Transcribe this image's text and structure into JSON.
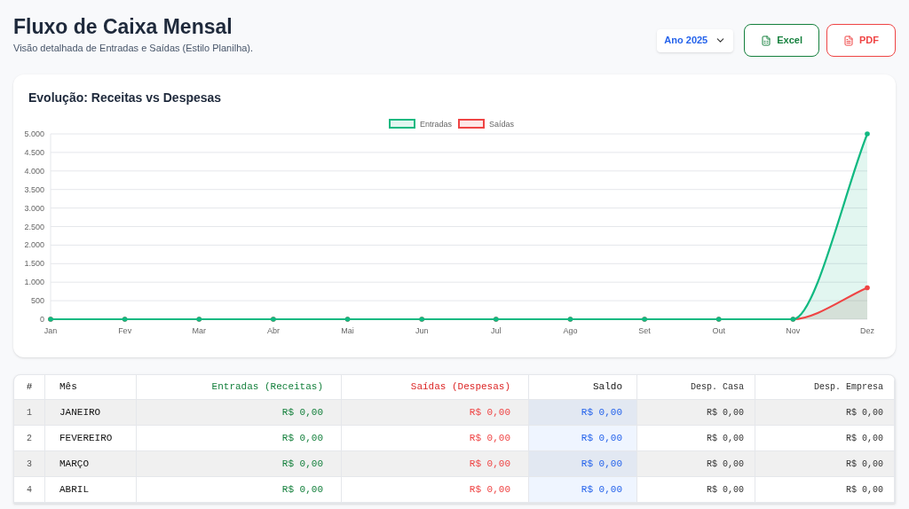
{
  "header": {
    "title": "Fluxo de Caixa Mensal",
    "subtitle": "Visão detalhada de Entradas e Saídas (Estilo Planilha).",
    "year_select": "Ano 2025",
    "buttons": [
      {
        "kind": "excel",
        "label": "Excel"
      },
      {
        "kind": "pdf",
        "label": "PDF"
      }
    ]
  },
  "chart_card": {
    "title": "Evolução: Receitas vs Despesas",
    "chart_data": {
      "type": "area",
      "grid": true,
      "legend": true,
      "categories": [
        "Jan",
        "Fev",
        "Mar",
        "Abr",
        "Mai",
        "Jun",
        "Jul",
        "Ago",
        "Set",
        "Out",
        "Nov",
        "Dez"
      ],
      "ylim": [
        0,
        5000
      ],
      "yticks": [
        {
          "value": 0,
          "label": "0"
        },
        {
          "value": 500,
          "label": "500"
        },
        {
          "value": 1000,
          "label": "1.000"
        },
        {
          "value": 1500,
          "label": "1.500"
        },
        {
          "value": 2000,
          "label": "2.000"
        },
        {
          "value": 2500,
          "label": "2.500"
        },
        {
          "value": 3000,
          "label": "3.000"
        },
        {
          "value": 3500,
          "label": "3.500"
        },
        {
          "value": 4000,
          "label": "4.000"
        },
        {
          "value": 4500,
          "label": "4.500"
        },
        {
          "value": 5000,
          "label": "5.000"
        }
      ],
      "series": [
        {
          "name": "Entradas",
          "color": "#10b981",
          "values": [
            0,
            0,
            0,
            0,
            0,
            0,
            0,
            0,
            0,
            0,
            0,
            5000
          ]
        },
        {
          "name": "Saídas",
          "color": "#ef4444",
          "values": [
            0,
            0,
            0,
            0,
            0,
            0,
            0,
            0,
            0,
            0,
            0,
            850
          ]
        }
      ]
    }
  },
  "table": {
    "columns": [
      "#",
      "Mês",
      "Entradas (Receitas)",
      "Saídas (Despesas)",
      "Saldo",
      "Desp. Casa",
      "Desp. Empresa"
    ],
    "rows": [
      {
        "n": "1",
        "month": "JANEIRO",
        "entradas": "R$ 0,00",
        "saidas": "R$ 0,00",
        "saldo": "R$ 0,00",
        "casa": "R$ 0,00",
        "empresa": "R$ 0,00"
      },
      {
        "n": "2",
        "month": "FEVEREIRO",
        "entradas": "R$ 0,00",
        "saidas": "R$ 0,00",
        "saldo": "R$ 0,00",
        "casa": "R$ 0,00",
        "empresa": "R$ 0,00"
      },
      {
        "n": "3",
        "month": "MARÇO",
        "entradas": "R$ 0,00",
        "saidas": "R$ 0,00",
        "saldo": "R$ 0,00",
        "casa": "R$ 0,00",
        "empresa": "R$ 0,00"
      },
      {
        "n": "4",
        "month": "ABRIL",
        "entradas": "R$ 0,00",
        "saidas": "R$ 0,00",
        "saldo": "R$ 0,00",
        "casa": "R$ 0,00",
        "empresa": "R$ 0,00"
      }
    ]
  }
}
